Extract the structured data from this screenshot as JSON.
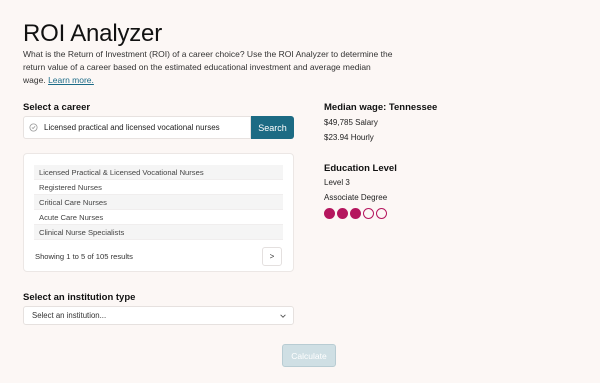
{
  "page": {
    "title": "ROI Analyzer",
    "intro": "What is the Return of Investment (ROI) of a career choice? Use the ROI Analyzer to determine the return value of a career based on the estimated educational investment and average median wage.",
    "learn_more": "Learn more."
  },
  "career": {
    "label": "Select a career",
    "search_value": "Licensed practical and licensed vocational nurses",
    "search_button": "Search",
    "results": [
      "Licensed Practical & Licensed Vocational Nurses",
      "Registered Nurses",
      "Critical Care Nurses",
      "Acute Care Nurses",
      "Clinical Nurse Specialists"
    ],
    "results_count": "Showing 1 to 5 of 105 results",
    "next_label": ">"
  },
  "institution": {
    "label": "Select an institution type",
    "selected": "Select an institution..."
  },
  "calculate_label": "Calculate",
  "wage": {
    "heading": "Median wage: Tennessee",
    "salary": "$49,785 Salary",
    "hourly": "$23.94 Hourly"
  },
  "education": {
    "heading": "Education Level",
    "level": "Level 3",
    "degree": "Associate Degree",
    "level_filled": 3,
    "level_total": 5
  },
  "colors": {
    "accent": "#1c6b84",
    "level": "#b5165e",
    "background": "#fcf7f5"
  },
  "icons": {
    "search": "search-icon",
    "chevron": "chevron-down-icon"
  }
}
